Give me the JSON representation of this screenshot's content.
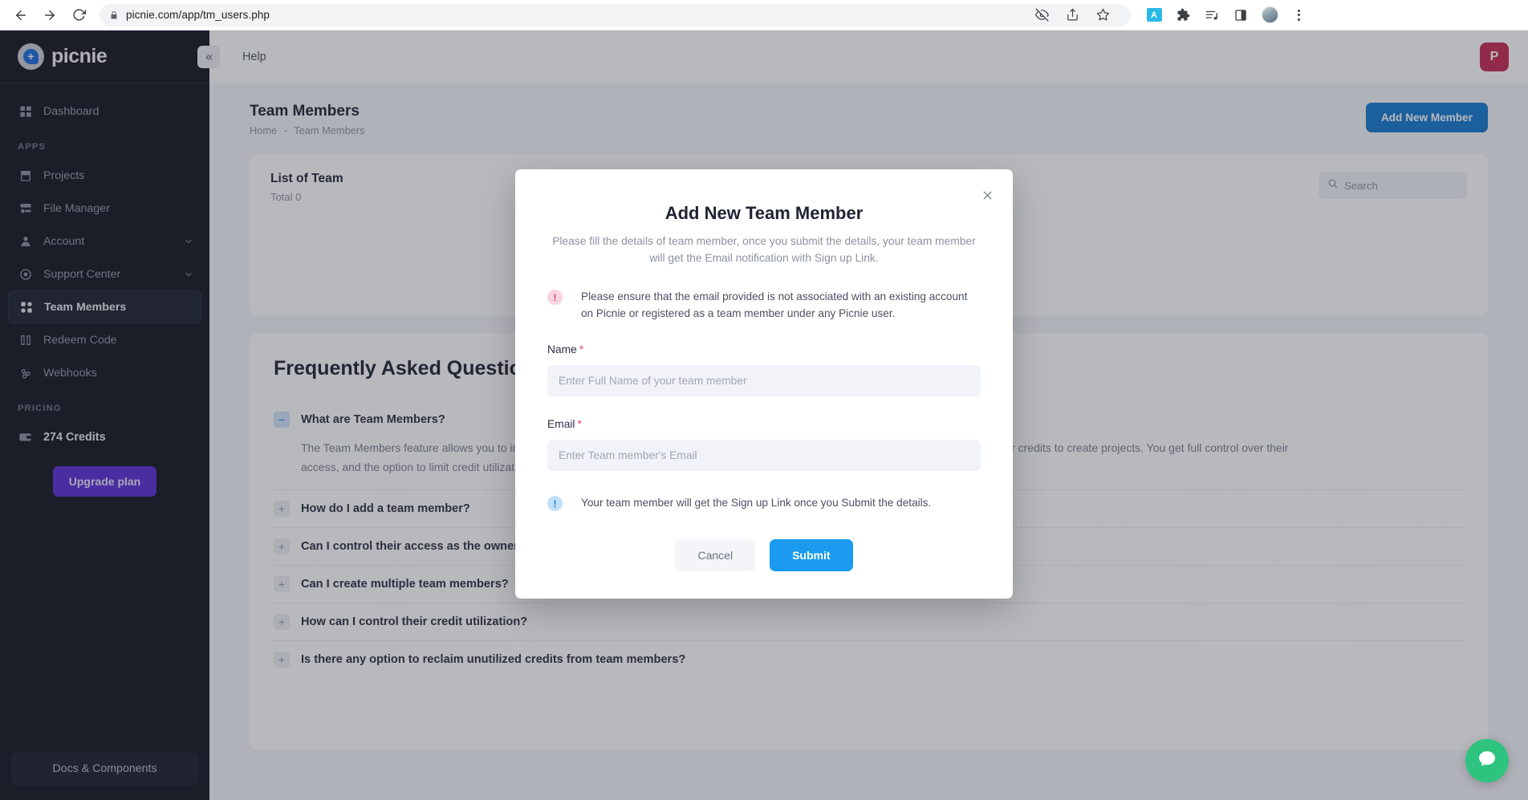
{
  "browser": {
    "url": "picnie.com/app/tm_users.php",
    "back_icon": "back-arrow-icon",
    "forward_icon": "forward-arrow-icon",
    "reload_icon": "reload-icon",
    "lock_icon": "lock-icon",
    "toolbar_icons": [
      "eye-off-icon",
      "share-icon",
      "bookmark-star-icon",
      "extension-blue-icon",
      "puzzle-extension-icon",
      "playlist-music-icon",
      "side-panel-icon",
      "profile-avatar-icon",
      "kebab-menu-icon"
    ]
  },
  "sidebar": {
    "brand": "picnie",
    "items": [
      {
        "label": "Dashboard",
        "icon": "dashboard-grid-icon",
        "active": false,
        "expandable": false
      },
      {
        "label": "Projects",
        "icon": "projects-box-icon",
        "active": false,
        "expandable": false
      },
      {
        "label": "File Manager",
        "icon": "file-manager-icon",
        "active": false,
        "expandable": false
      },
      {
        "label": "Account",
        "icon": "account-user-icon",
        "active": false,
        "expandable": true
      },
      {
        "label": "Support Center",
        "icon": "support-lifebuoy-icon",
        "active": false,
        "expandable": true
      },
      {
        "label": "Team Members",
        "icon": "team-members-icon",
        "active": true,
        "expandable": false
      },
      {
        "label": "Redeem Code",
        "icon": "redeem-ticket-icon",
        "active": false,
        "expandable": false
      },
      {
        "label": "Webhooks",
        "icon": "webhooks-icon",
        "active": false,
        "expandable": false
      }
    ],
    "section_apps": "APPS",
    "section_pricing": "PRICING",
    "credits": "274 Credits",
    "credits_icon": "credits-wallet-icon",
    "upgrade_label": "Upgrade plan",
    "upgrade_color": "#5b2fd6",
    "docs_label": "Docs & Components"
  },
  "topbar": {
    "collapse_icon": "collapse-sidebar-icon",
    "help_label": "Help",
    "user_initial": "P",
    "user_badge_color": "#c62a52"
  },
  "page": {
    "title": "Team Members",
    "breadcrumb_home": "Home",
    "breadcrumb_sep": "-",
    "breadcrumb_current": "Team Members",
    "add_button": "Add New Member",
    "add_button_color": "#1779d0"
  },
  "list_card": {
    "title": "List of Team",
    "total": "Total 0",
    "search_placeholder": "Search",
    "search_value": "",
    "search_icon": "search-icon"
  },
  "faq": {
    "heading": "Frequently Asked Questions",
    "items": [
      {
        "question": "What are Team Members?",
        "answer": "The Team Members feature allows you to invite and manage users under your account. They will have their separate accounts but can use your credits to create projects. You get full control over their access, and the option to limit credit utilization.",
        "expanded": true
      },
      {
        "question": "How do I add a team member?",
        "answer": "",
        "expanded": false
      },
      {
        "question": "Can I control their access as the owner?",
        "answer": "",
        "expanded": false
      },
      {
        "question": "Can I create multiple team members?",
        "answer": "",
        "expanded": false
      },
      {
        "question": "How can I control their credit utilization?",
        "answer": "",
        "expanded": false
      },
      {
        "question": "Is there any option to reclaim unutilized credits from team members?",
        "answer": "",
        "expanded": false
      }
    ]
  },
  "modal": {
    "title": "Add New Team Member",
    "subtitle": "Please fill the details of team member, once you submit the details, your team member will get the Email notification with Sign up Link.",
    "close_icon": "close-icon",
    "warning_icon": "warning-exclamation-icon",
    "warning_text": "Please ensure that the email provided is not associated with an existing account on Picnie or registered as a team member under any Picnie user.",
    "info_icon": "info-exclamation-icon",
    "info_text": "Your team member will get the Sign up Link once you Submit the details.",
    "name_label": "Name",
    "name_required": "*",
    "name_placeholder": "Enter Full Name of your team member",
    "name_value": "",
    "email_label": "Email",
    "email_required": "*",
    "email_placeholder": "Enter Team member's Email",
    "email_value": "",
    "cancel_label": "Cancel",
    "submit_label": "Submit",
    "submit_color": "#1a9bf0"
  },
  "chat_widget": {
    "icon": "chat-bubble-icon",
    "color": "#2ec37f"
  }
}
